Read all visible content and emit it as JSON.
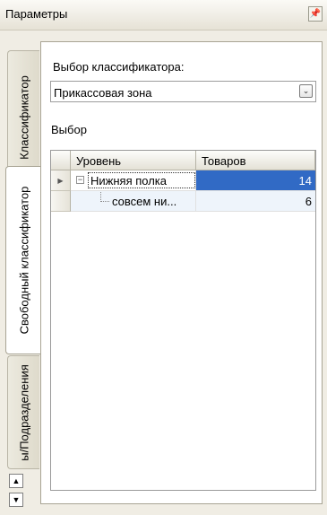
{
  "window": {
    "title": "Параметры",
    "pin_icon": "pin-icon"
  },
  "tabs": [
    {
      "label": "Классификатор",
      "active": false
    },
    {
      "label": "Свободный классификатор",
      "active": true
    },
    {
      "label": "ы/Подразделения",
      "active": false
    }
  ],
  "panel": {
    "classifier_label": "Выбор классификатора:",
    "classifier_value": "Прикассовая зона",
    "select_label": "Выбор"
  },
  "grid": {
    "columns": [
      "Уровень",
      "Товаров"
    ],
    "rows": [
      {
        "level": "Нижняя полка",
        "count": "14",
        "expanded": true,
        "current": true
      },
      {
        "level": "совсем ни...",
        "count": "6",
        "expanded": false,
        "current": false
      }
    ]
  },
  "colors": {
    "selection": "#316ac5",
    "panel_bg": "#f0ede4"
  }
}
